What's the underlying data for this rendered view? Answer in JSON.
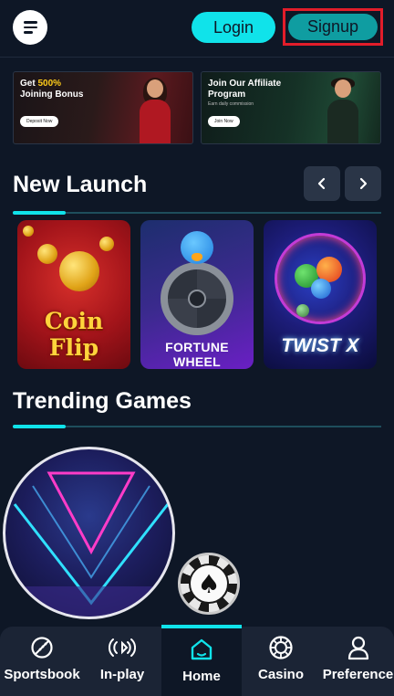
{
  "header": {
    "menu_icon": "hamburger-menu-icon",
    "login_label": "Login",
    "signup_label": "Signup",
    "highlight_color": "#e21d2a",
    "accent_color": "#10e3ea"
  },
  "banners": [
    {
      "title_prefix": "Get ",
      "title_highlight": "500%",
      "title_rest": "Joining Bonus",
      "cta": "Deposit Now"
    },
    {
      "title_prefix": "",
      "title_highlight": "",
      "title_rest": "Join Our Affiliate Program",
      "subtitle": "Earn daily commission",
      "cta": "Join Now"
    }
  ],
  "new_launch": {
    "title": "New Launch",
    "prev_icon": "chevron-left-icon",
    "next_icon": "chevron-right-icon",
    "games": [
      {
        "name": "Coin Flip"
      },
      {
        "name": "FORTUNE WHEEL"
      },
      {
        "name": "TWIST X"
      }
    ]
  },
  "trending": {
    "title": "Trending Games"
  },
  "bottom_nav": {
    "items": [
      {
        "label": "Sportsbook",
        "icon": "sportsbook-icon"
      },
      {
        "label": "In-play",
        "icon": "broadcast-icon"
      },
      {
        "label": "Home",
        "icon": "home-icon",
        "active": true
      },
      {
        "label": "Casino",
        "icon": "casino-chip-icon"
      },
      {
        "label": "Preference",
        "icon": "user-icon"
      }
    ]
  }
}
